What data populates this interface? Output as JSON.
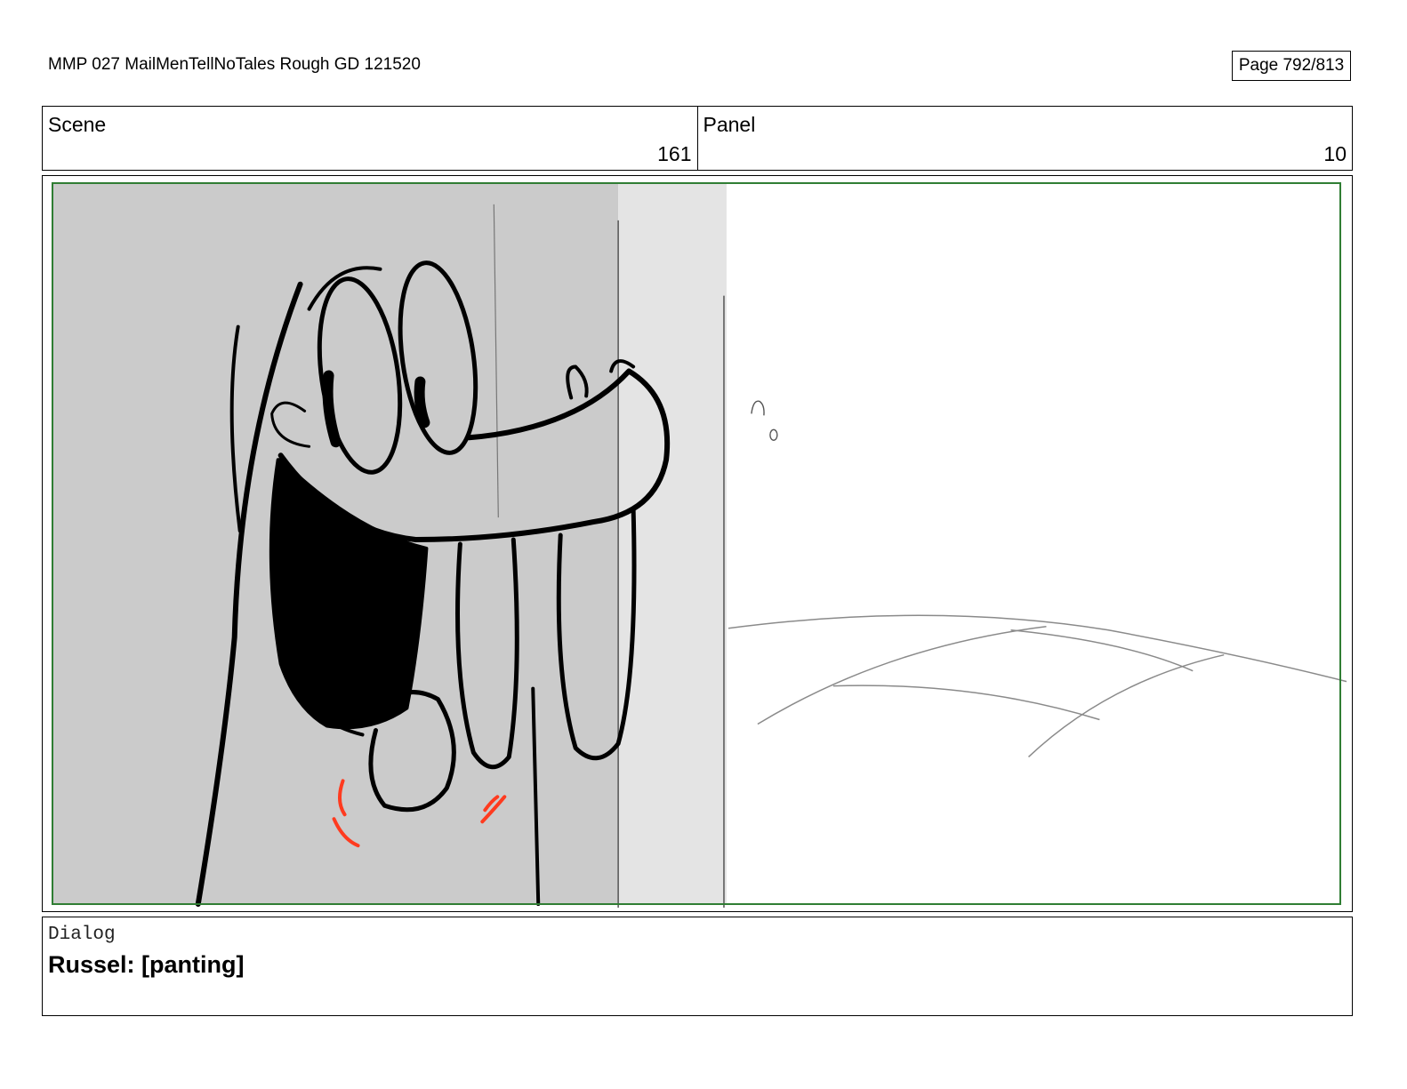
{
  "document": {
    "title": "MMP 027 MailMenTellNoTales Rough GD 121520",
    "page_label": "Page 792/813"
  },
  "header": {
    "scene_label": "Scene",
    "scene_value": "161",
    "panel_label": "Panel",
    "panel_value": "10"
  },
  "panel": {
    "safe_frame_color": "#2e7d32",
    "accent_color": "#ff3b1f",
    "wall_shadow_color": "#cbcbcb",
    "wall_edge_color": "#e4e4e4"
  },
  "dialog": {
    "label": "Dialog",
    "text": "Russel: [panting]"
  }
}
